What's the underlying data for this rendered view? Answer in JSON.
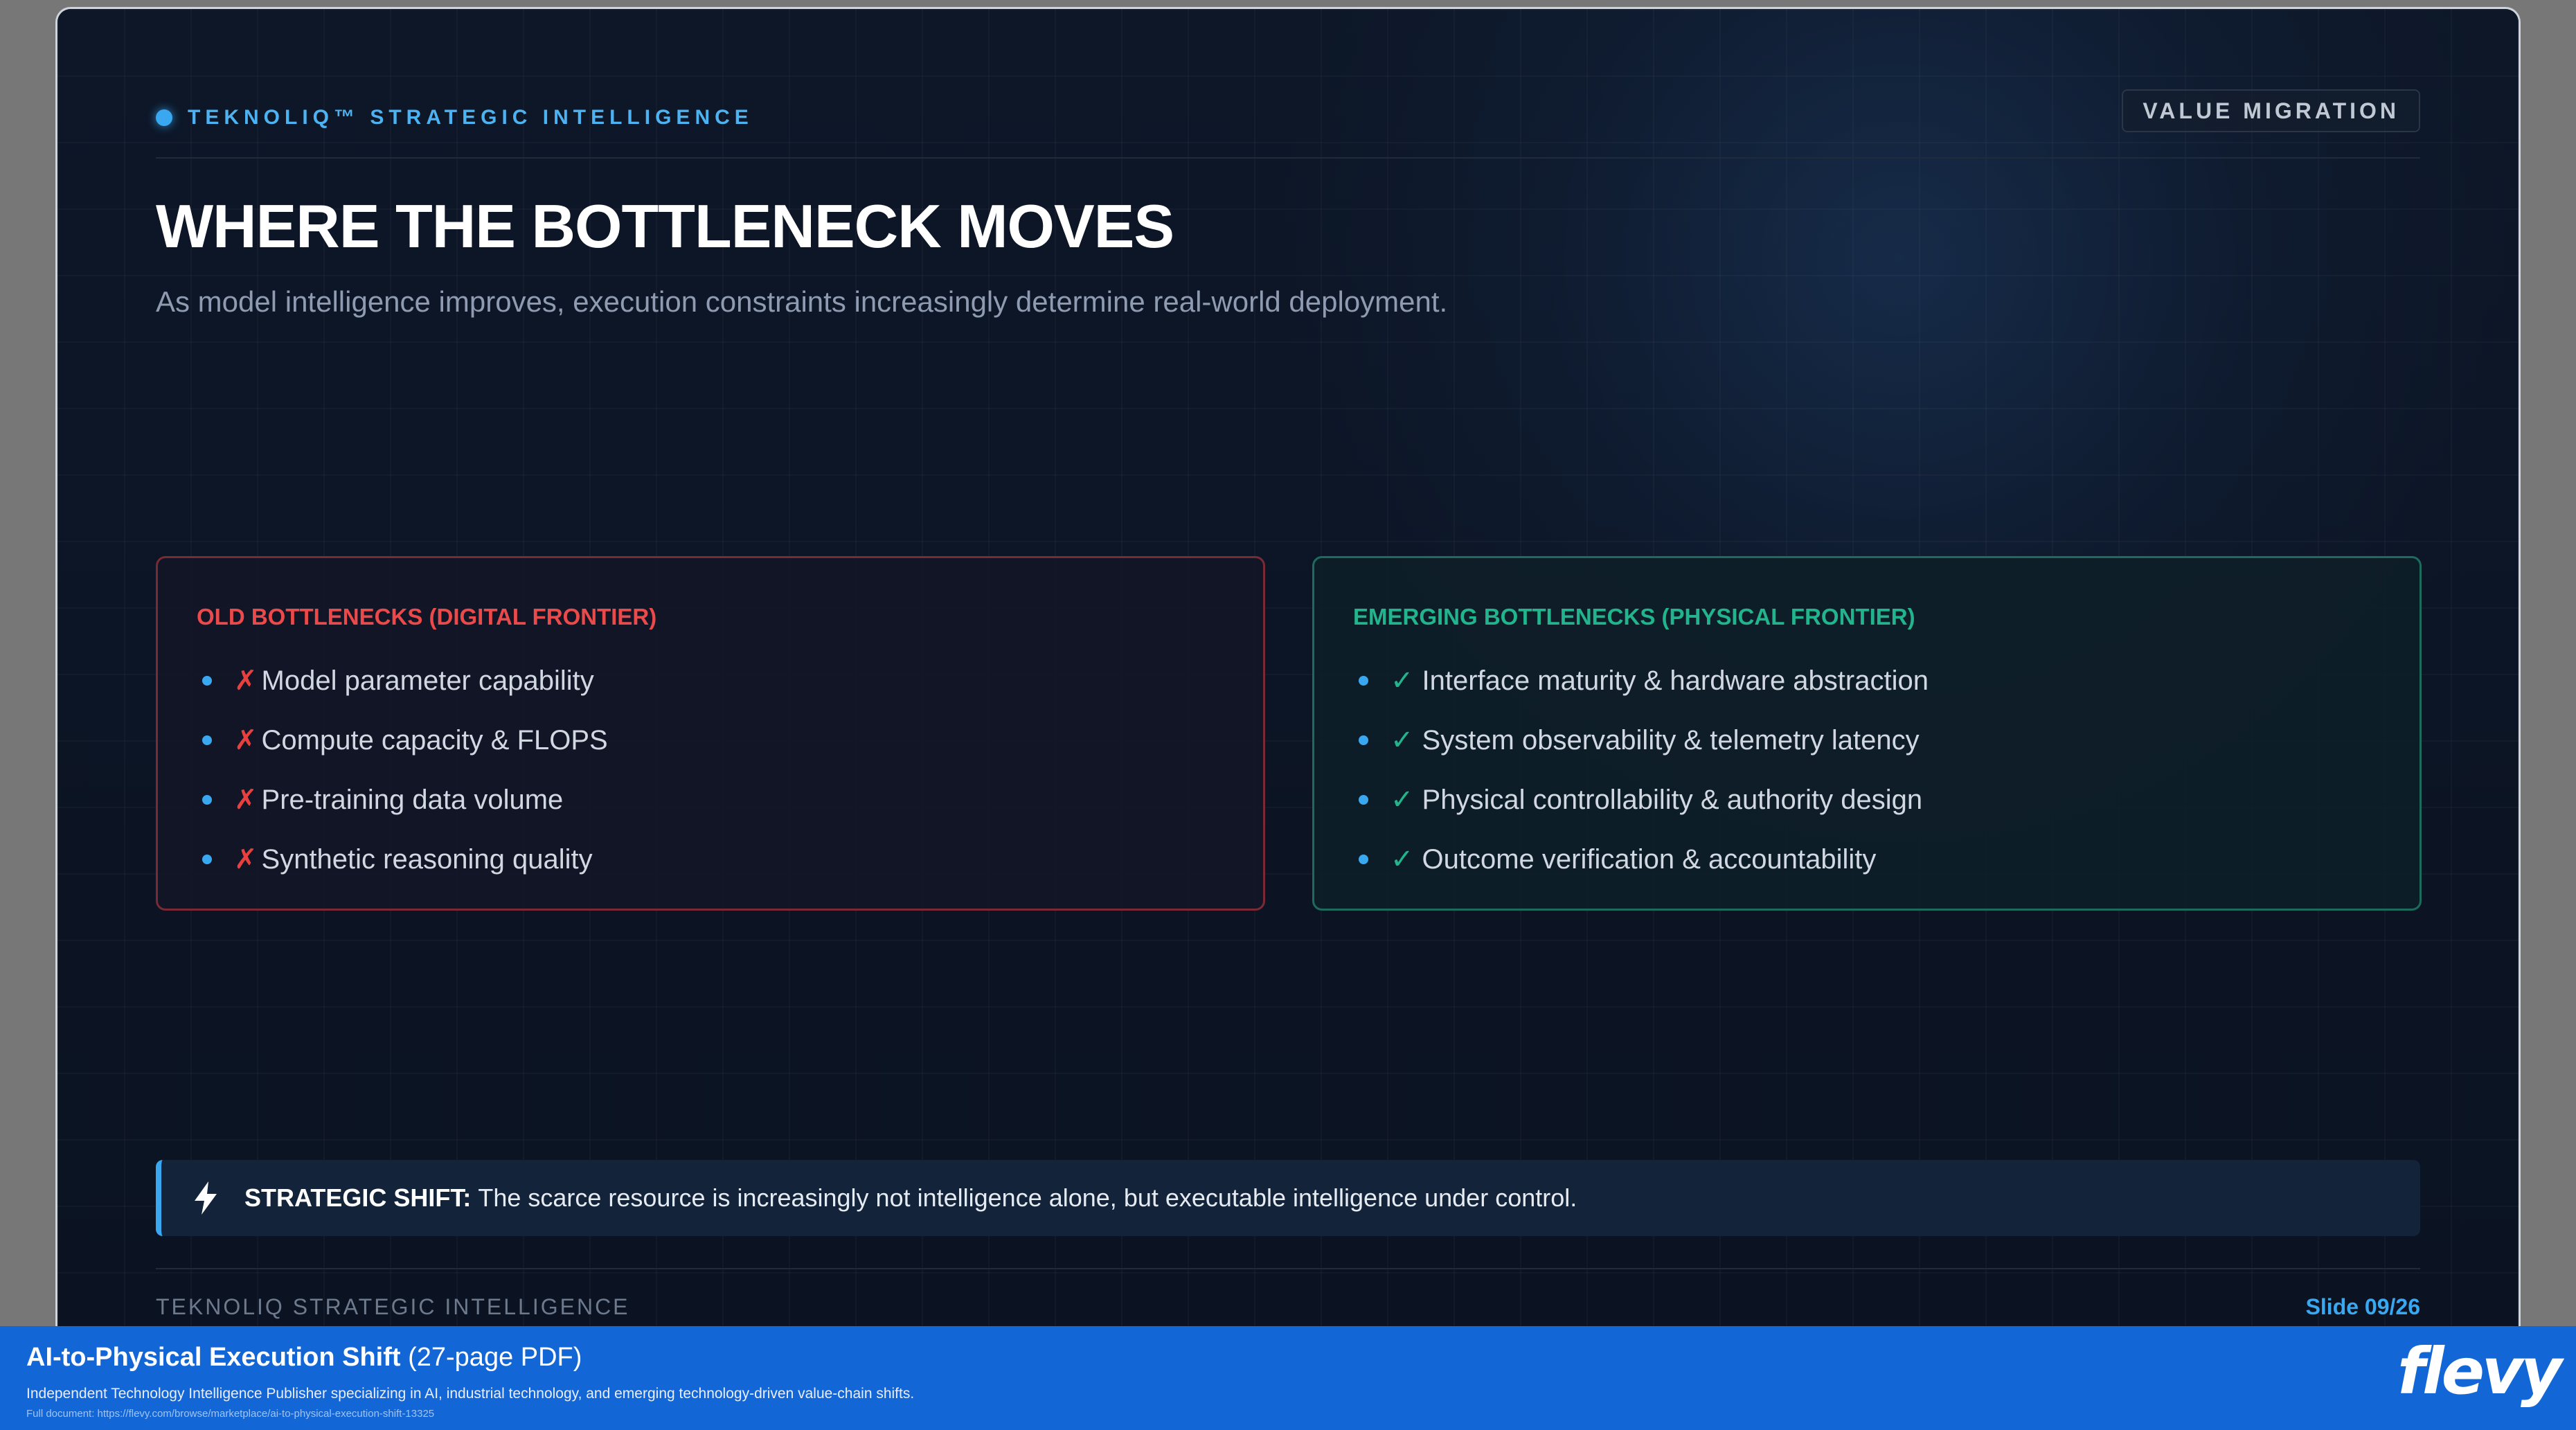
{
  "header": {
    "brand": "TEKNOLIQ™ STRATEGIC INTELLIGENCE",
    "tag": "VALUE MIGRATION"
  },
  "main": {
    "title": "WHERE THE BOTTLENECK MOVES",
    "subtitle": "As model intelligence improves, execution constraints increasingly determine real-world deployment."
  },
  "old_card": {
    "title": "OLD BOTTLENECKS (DIGITAL FRONTIER)",
    "mark": "✗",
    "items": [
      "Model parameter capability",
      "Compute capacity & FLOPS",
      "Pre-training data volume",
      "Synthetic reasoning quality"
    ]
  },
  "new_card": {
    "title": "EMERGING BOTTLENECKS (PHYSICAL FRONTIER)",
    "mark": "✓",
    "items": [
      "Interface maturity & hardware abstraction",
      "System observability & telemetry latency",
      "Physical controllability & authority design",
      "Outcome verification & accountability"
    ]
  },
  "callout": {
    "icon": "lightning-icon",
    "label": "STRATEGIC SHIFT:",
    "text": "The scarce resource is increasingly not intelligence alone, but executable intelligence under control."
  },
  "footer": {
    "left": "TEKNOLIQ STRATEGIC INTELLIGENCE",
    "slide": "Slide 09/26"
  },
  "banner": {
    "title": "AI-to-Physical Execution Shift",
    "pages": "(27-page PDF)",
    "description": "Independent Technology Intelligence Publisher specializing in AI, industrial technology, and emerging technology-driven value-chain shifts.",
    "link": "Full document: https://flevy.com/browse/marketplace/ai-to-physical-execution-shift-13325",
    "logo": "flevy"
  },
  "colors": {
    "accent": "#3aa8f0",
    "old_red": "#ea4a4a",
    "new_green": "#22b48c",
    "banner_blue": "#1366d6"
  }
}
